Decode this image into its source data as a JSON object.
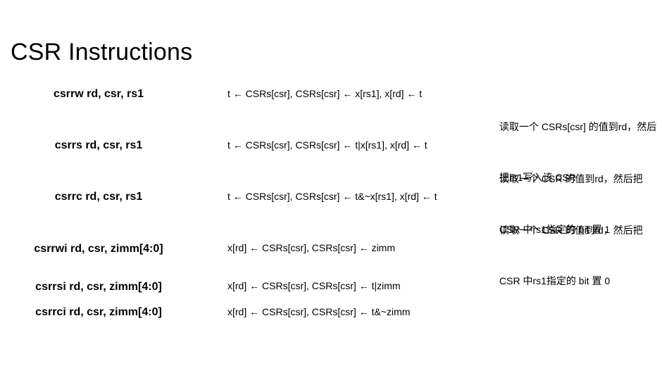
{
  "title": "CSR Instructions",
  "rows": [
    {
      "instruction": "csrrw rd, csr, rs1",
      "semantics": "t ← CSRs[csr], CSRs[csr] ← x[rs1], x[rd] ← t",
      "description_line1": "读取一个 CSRs[csr] 的值到rd，然后",
      "description_line2": "把rs1写入该 CSR"
    },
    {
      "instruction": "csrrs rd, csr, rs1",
      "semantics": "t ← CSRs[csr], CSRs[csr] ← t|x[rs1], x[rd] ← t",
      "description_line1": "读取一个 CSR 的值到rd，然后把",
      "description_line2": "CSR 中rs1指定的 bit 置 1"
    },
    {
      "instruction": "csrrc rd, csr, rs1",
      "semantics": "t ← CSRs[csr], CSRs[csr] ← t&~x[rs1], x[rd] ← t",
      "description_line1": "读取一个 CSR 的值到rd，然后把",
      "description_line2": "CSR 中rs1指定的 bit 置 0"
    },
    {
      "instruction": "csrrwi rd, csr, zimm[4:0]",
      "semantics": "x[rd] ← CSRs[csr], CSRs[csr] ← zimm"
    },
    {
      "instruction": "csrrsi rd, csr, zimm[4:0]",
      "semantics": "x[rd] ← CSRs[csr], CSRs[csr] ← t|zimm"
    },
    {
      "instruction": "csrrci rd, csr, zimm[4:0]",
      "semantics": "x[rd] ← CSRs[csr], CSRs[csr] ← t&~zimm"
    }
  ]
}
